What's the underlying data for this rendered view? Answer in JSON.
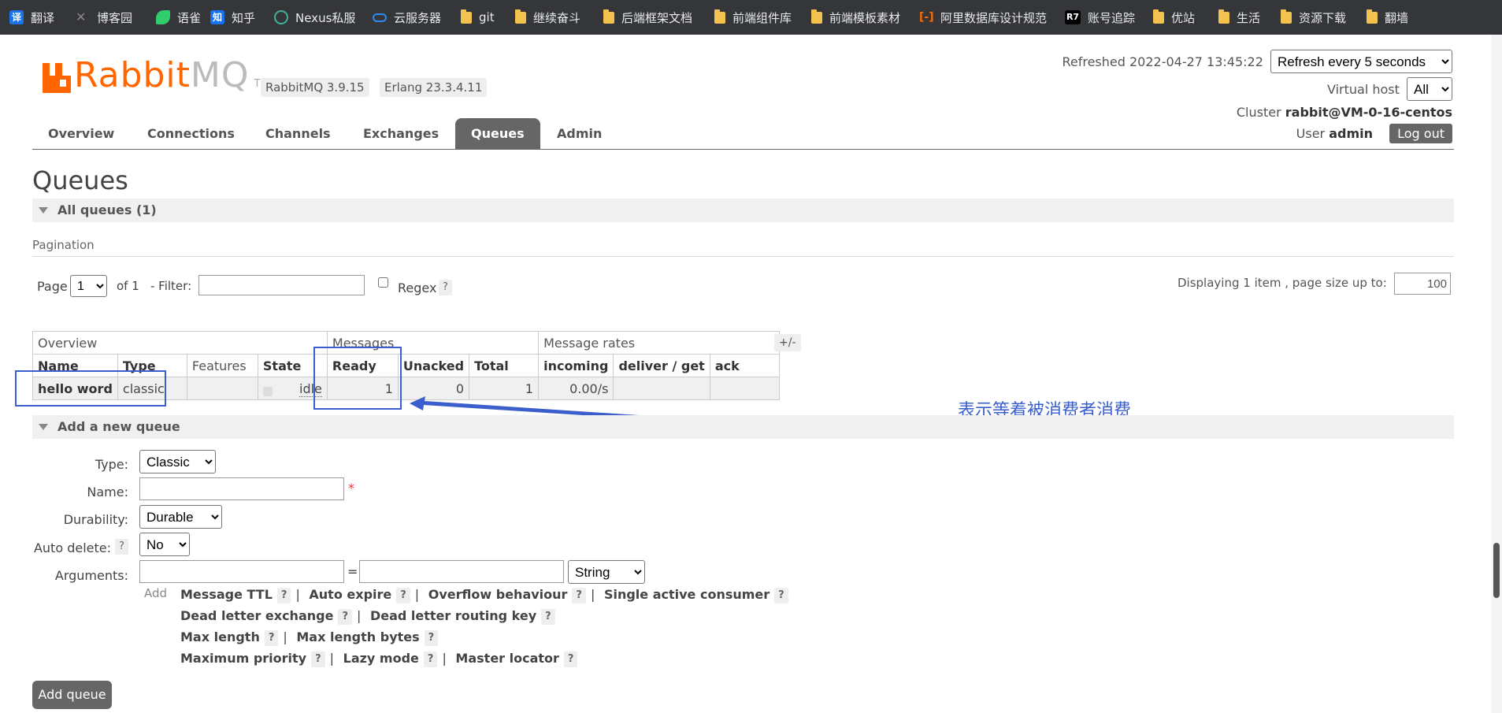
{
  "bookmarks": [
    {
      "label": "翻译",
      "icon": "translate-icon"
    },
    {
      "label": "博客园",
      "icon": "cnblogs-icon"
    },
    {
      "label": "语雀",
      "icon": "yuque-icon"
    },
    {
      "label": "知乎",
      "icon": "zhihu-icon"
    },
    {
      "label": "Nexus私服",
      "icon": "nexus-icon"
    },
    {
      "label": "云服务器",
      "icon": "cloud-icon"
    },
    {
      "label": "git",
      "icon": "folder-icon"
    },
    {
      "label": "继续奋斗",
      "icon": "folder-icon"
    },
    {
      "label": "后端框架文档",
      "icon": "folder-icon"
    },
    {
      "label": "前端组件库",
      "icon": "folder-icon"
    },
    {
      "label": "前端模板素材",
      "icon": "folder-icon"
    },
    {
      "label": "阿里数据库设计规范",
      "icon": "aliyun-icon"
    },
    {
      "label": "账号追踪",
      "icon": "r7-icon"
    },
    {
      "label": "优站",
      "icon": "folder-icon"
    },
    {
      "label": "生活",
      "icon": "folder-icon"
    },
    {
      "label": "资源下载",
      "icon": "folder-icon"
    },
    {
      "label": "翻墙",
      "icon": "folder-icon"
    }
  ],
  "header": {
    "logo_r": "Rabbit",
    "logo_m": "MQ",
    "logo_tm": "TM",
    "version": "RabbitMQ 3.9.15",
    "erlang": "Erlang 23.3.4.11",
    "refreshed": "Refreshed 2022-04-27 13:45:22",
    "refresh_option": "Refresh every 5 seconds",
    "vhost_label": "Virtual host",
    "vhost_option": "All",
    "cluster_label": "Cluster",
    "cluster_value": "rabbit@VM-0-16-centos",
    "user_label": "User",
    "user_value": "admin",
    "logout": "Log out"
  },
  "nav": [
    "Overview",
    "Connections",
    "Channels",
    "Exchanges",
    "Queues",
    "Admin"
  ],
  "page_title": "Queues",
  "all_queues": "All queues (1)",
  "pagination": {
    "label": "Pagination",
    "page_label": "Page",
    "page_value": "1",
    "of": "of 1",
    "filter_label": "- Filter:",
    "regex_label": "Regex",
    "help": "?",
    "displaying": "Displaying 1 item , page size up to:",
    "page_size": "100"
  },
  "table": {
    "groups": [
      "Overview",
      "Messages",
      "Message rates"
    ],
    "columns": [
      "Name",
      "Type",
      "Features",
      "State",
      "Ready",
      "Unacked",
      "Total",
      "incoming",
      "deliver / get",
      "ack"
    ],
    "row": {
      "name": "hello word",
      "type": "classic",
      "features": "",
      "state": "idle",
      "ready": "1",
      "unacked": "0",
      "total": "1",
      "incoming": "0.00/s",
      "deliver_get": "",
      "ack": ""
    },
    "plusminus": "+/-"
  },
  "annotation": "表示等着被消费者消费",
  "add_queue": {
    "section": "Add a new queue",
    "type_label": "Type:",
    "type_value": "Classic",
    "name_label": "Name:",
    "required": "*",
    "durability_label": "Durability:",
    "durability_value": "Durable",
    "autodelete_label": "Auto delete:",
    "autodelete_value": "No",
    "arguments_label": "Arguments:",
    "equals": "=",
    "arg_type": "String",
    "add": "Add",
    "args_line1": [
      "Message TTL",
      "Auto expire",
      "Overflow behaviour",
      "Single active consumer"
    ],
    "args_line2": [
      "Dead letter exchange",
      "Dead letter routing key"
    ],
    "args_line3": [
      "Max length",
      "Max length bytes"
    ],
    "args_line4": [
      "Maximum priority",
      "Lazy mode",
      "Master locator"
    ],
    "button": "Add queue"
  }
}
